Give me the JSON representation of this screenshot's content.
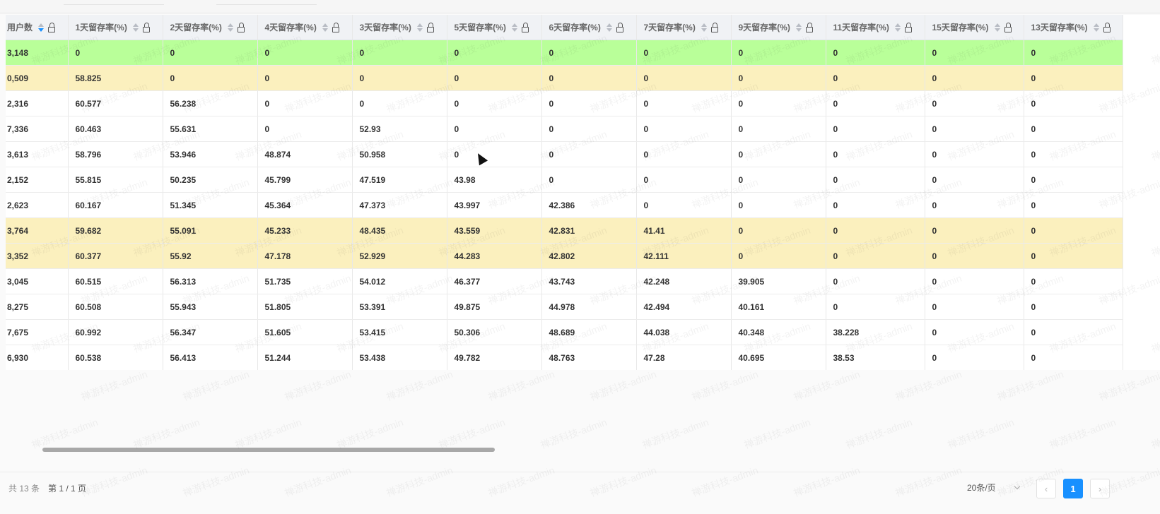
{
  "watermark": "禅游科技-admin",
  "table": {
    "columns": [
      {
        "label": "用户数",
        "sort": "desc"
      },
      {
        "label": "1天留存率(%)"
      },
      {
        "label": "2天留存率(%)"
      },
      {
        "label": "4天留存率(%)"
      },
      {
        "label": "3天留存率(%)"
      },
      {
        "label": "5天留存率(%)"
      },
      {
        "label": "6天留存率(%)"
      },
      {
        "label": "7天留存率(%)"
      },
      {
        "label": "9天留存率(%)"
      },
      {
        "label": "11天留存率(%)"
      },
      {
        "label": "15天留存率(%)"
      },
      {
        "label": "13天留存率(%)"
      }
    ],
    "rows": [
      {
        "highlight": "green",
        "cells": [
          "3,148",
          "0",
          "0",
          "0",
          "0",
          "0",
          "0",
          "0",
          "0",
          "0",
          "0",
          "0"
        ]
      },
      {
        "highlight": "yellow",
        "cells": [
          "0,509",
          "58.825",
          "0",
          "0",
          "0",
          "0",
          "0",
          "0",
          "0",
          "0",
          "0",
          "0"
        ]
      },
      {
        "highlight": "",
        "cells": [
          "2,316",
          "60.577",
          "56.238",
          "0",
          "0",
          "0",
          "0",
          "0",
          "0",
          "0",
          "0",
          "0"
        ]
      },
      {
        "highlight": "",
        "cells": [
          "7,336",
          "60.463",
          "55.631",
          "0",
          "52.93",
          "0",
          "0",
          "0",
          "0",
          "0",
          "0",
          "0"
        ]
      },
      {
        "highlight": "",
        "cells": [
          "3,613",
          "58.796",
          "53.946",
          "48.874",
          "50.958",
          "0",
          "0",
          "0",
          "0",
          "0",
          "0",
          "0"
        ]
      },
      {
        "highlight": "",
        "cells": [
          "2,152",
          "55.815",
          "50.235",
          "45.799",
          "47.519",
          "43.98",
          "0",
          "0",
          "0",
          "0",
          "0",
          "0"
        ]
      },
      {
        "highlight": "",
        "cells": [
          "2,623",
          "60.167",
          "51.345",
          "45.364",
          "47.373",
          "43.997",
          "42.386",
          "0",
          "0",
          "0",
          "0",
          "0"
        ]
      },
      {
        "highlight": "yellow",
        "cells": [
          "3,764",
          "59.682",
          "55.091",
          "45.233",
          "48.435",
          "43.559",
          "42.831",
          "41.41",
          "0",
          "0",
          "0",
          "0"
        ]
      },
      {
        "highlight": "yellow",
        "cells": [
          "3,352",
          "60.377",
          "55.92",
          "47.178",
          "52.929",
          "44.283",
          "42.802",
          "42.111",
          "0",
          "0",
          "0",
          "0"
        ]
      },
      {
        "highlight": "",
        "cells": [
          "3,045",
          "60.515",
          "56.313",
          "51.735",
          "54.012",
          "46.377",
          "43.743",
          "42.248",
          "39.905",
          "0",
          "0",
          "0"
        ]
      },
      {
        "highlight": "",
        "cells": [
          "8,275",
          "60.508",
          "55.943",
          "51.805",
          "53.391",
          "49.875",
          "44.978",
          "42.494",
          "40.161",
          "0",
          "0",
          "0"
        ]
      },
      {
        "highlight": "",
        "cells": [
          "7,675",
          "60.992",
          "56.347",
          "51.605",
          "53.415",
          "50.306",
          "48.689",
          "44.038",
          "40.348",
          "38.228",
          "0",
          "0"
        ]
      },
      {
        "highlight": "",
        "cells": [
          "6,930",
          "60.538",
          "56.413",
          "51.244",
          "53.438",
          "49.782",
          "48.763",
          "47.28",
          "40.695",
          "38.53",
          "0",
          "0"
        ]
      }
    ]
  },
  "pagination": {
    "total": "共 13 条",
    "page_info": "第 1 / 1 页",
    "page_size": "20条/页",
    "prev": "‹",
    "current": "1",
    "next": "›"
  },
  "colors": {
    "row_green": "#b9ff99",
    "row_yellow": "#fbf0be",
    "accent": "#1890ff"
  }
}
